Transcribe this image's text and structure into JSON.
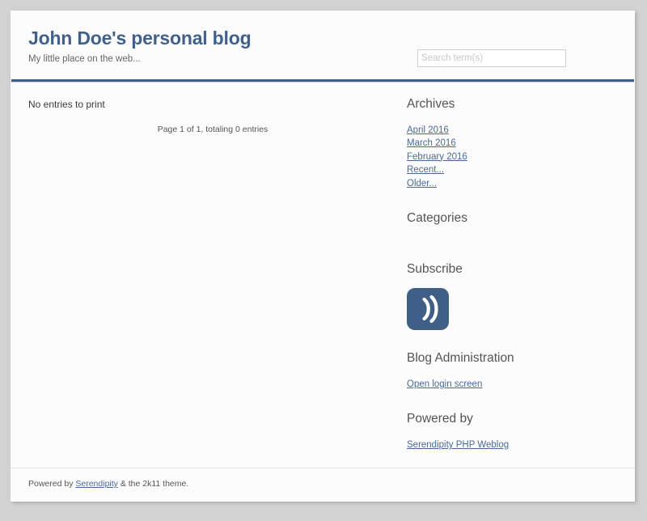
{
  "header": {
    "title": "John Doe's personal blog",
    "subtitle": "My little place on the web...",
    "search": {
      "placeholder": "Search term(s)",
      "value": ""
    }
  },
  "content": {
    "empty_message": "No entries to print",
    "pagination": "Page 1 of 1, totaling 0 entries"
  },
  "sidebar": {
    "plugins": [
      {
        "title": "Archives",
        "links": [
          "April 2016",
          "March 2016",
          "February 2016",
          "Recent...",
          "Older..."
        ]
      },
      {
        "title": "Categories",
        "links": []
      },
      {
        "title": "Subscribe",
        "icon": "rss-feed-icon",
        "links": []
      },
      {
        "title": "Blog Administration",
        "links": [
          "Open login screen"
        ]
      },
      {
        "title": "Powered by",
        "links": [
          "Serendipity PHP Weblog"
        ]
      }
    ]
  },
  "footer": {
    "prefix": "Powered by ",
    "link": "Serendipity",
    "suffix": " & the 2k11 theme."
  },
  "colors": {
    "page_background": "#d2d2d2",
    "card_background": "#fcfcfc",
    "brand": "#41618c",
    "rule": "#3f5f87",
    "link": "#4a6a96",
    "heading": "#555555",
    "rss_badge": "#3f5f87"
  }
}
